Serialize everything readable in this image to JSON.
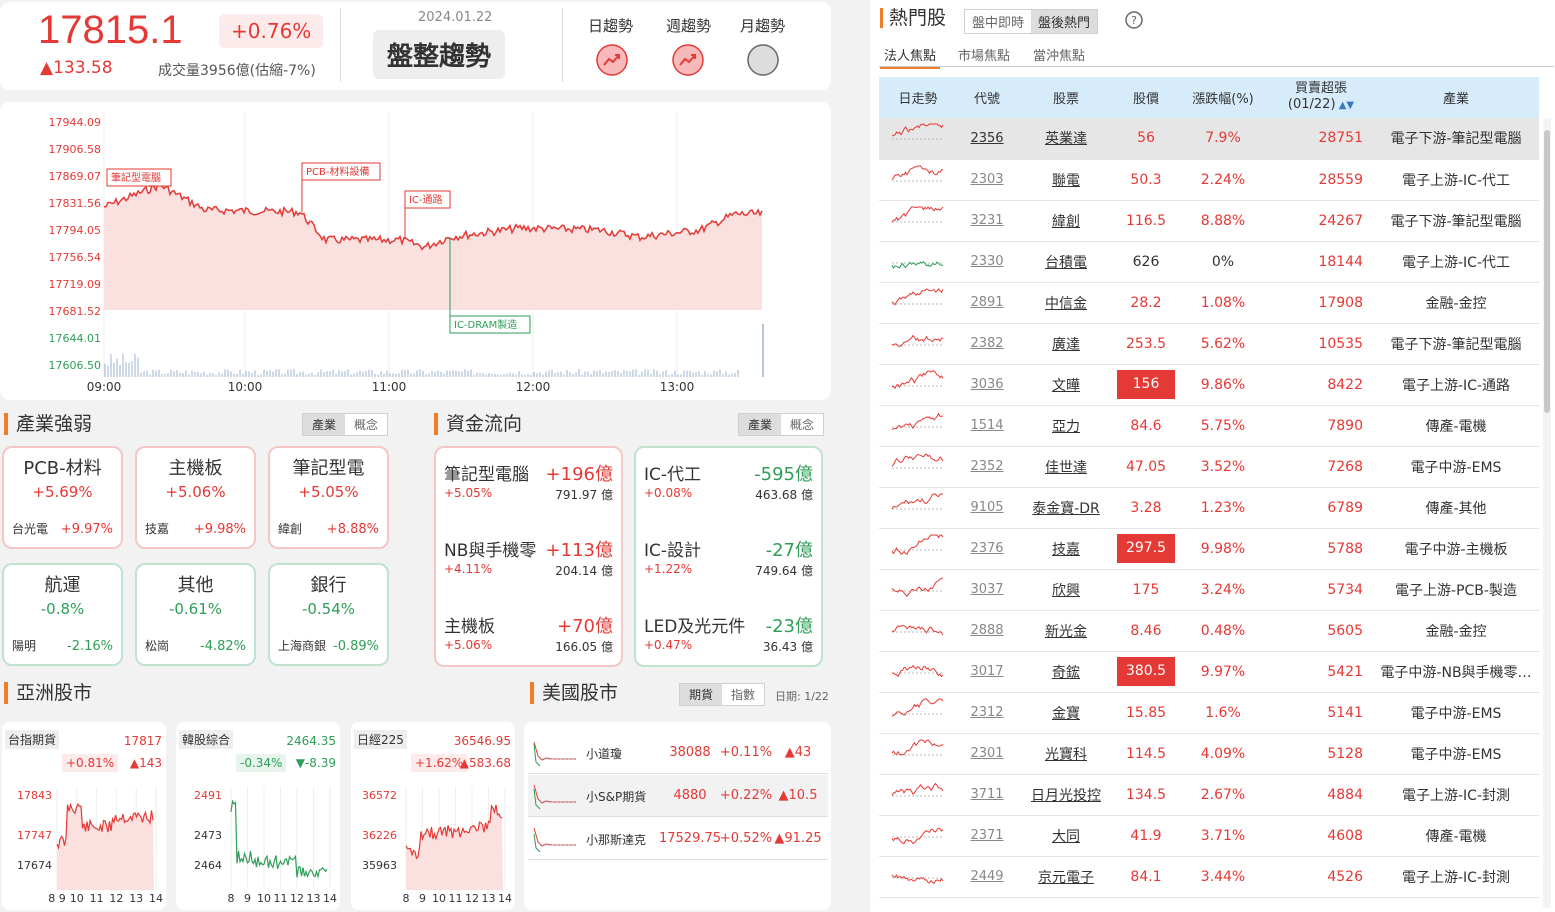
{
  "index": {
    "value": "17815.1",
    "pct": "+0.76%",
    "change": "▲133.58",
    "volume": "成交量3956億(估縮-7%)",
    "date": "2024.01.22",
    "trend": "盤整趨勢",
    "trend_labels": [
      "日趨勢",
      "週趨勢",
      "月趨勢"
    ]
  },
  "intraday": {
    "y_ticks": [
      "17944.09",
      "17906.58",
      "17869.07",
      "17831.56",
      "17794.05",
      "17756.54",
      "17719.09",
      "17681.52",
      "17644.01",
      "17606.50"
    ],
    "x_ticks": [
      "09:00",
      "10:00",
      "11:00",
      "12:00",
      "13:00"
    ],
    "tags": [
      "筆記型電腦",
      "PCB-材料設備",
      "IC-通路",
      "IC-DRAM製造"
    ]
  },
  "sector": {
    "title": "產業強弱",
    "tabs": [
      "產業",
      "概念"
    ],
    "cards": [
      {
        "name": "PCB-材料",
        "pct": "+5.69%",
        "stock": "台光電",
        "stock_pct": "+9.97%",
        "up": true
      },
      {
        "name": "主機板",
        "pct": "+5.06%",
        "stock": "技嘉",
        "stock_pct": "+9.98%",
        "up": true
      },
      {
        "name": "筆記型電",
        "pct": "+5.05%",
        "stock": "緯創",
        "stock_pct": "+8.88%",
        "up": true
      },
      {
        "name": "航運",
        "pct": "-0.8%",
        "stock": "陽明",
        "stock_pct": "-2.16%",
        "up": false
      },
      {
        "name": "其他",
        "pct": "-0.61%",
        "stock": "松崗",
        "stock_pct": "-4.82%",
        "up": false
      },
      {
        "name": "銀行",
        "pct": "-0.54%",
        "stock": "上海商銀",
        "stock_pct": "-0.89%",
        "up": false
      }
    ]
  },
  "flow": {
    "title": "資金流向",
    "tabs": [
      "產業",
      "概念"
    ],
    "in": [
      {
        "name": "筆記型電腦",
        "value": "+196億",
        "pct": "+5.05%",
        "amt": "791.97 億"
      },
      {
        "name": "NB與手機零",
        "value": "+113億",
        "pct": "+4.11%",
        "amt": "204.14 億"
      },
      {
        "name": "主機板",
        "value": "+70億",
        "pct": "+5.06%",
        "amt": "166.05 億"
      }
    ],
    "out": [
      {
        "name": "IC-代工",
        "value": "-595億",
        "pct": "+0.08%",
        "amt": "463.68 億"
      },
      {
        "name": "IC-設計",
        "value": "-27億",
        "pct": "+1.22%",
        "amt": "749.64 億"
      },
      {
        "name": "LED及光元件",
        "value": "-23億",
        "pct": "+0.47%",
        "amt": "36.43 億"
      }
    ]
  },
  "asia": {
    "title": "亞洲股市",
    "charts": [
      {
        "name": "台指期貨",
        "value": "17817",
        "pct": "+0.81%",
        "chg": "▲143",
        "y": [
          "17843",
          "17747",
          "17674"
        ],
        "x": [
          "8 9",
          "10",
          "11",
          "12",
          "13",
          "14"
        ],
        "up": true
      },
      {
        "name": "韓股綜合",
        "value": "2464.35",
        "pct": "-0.34%",
        "chg": "▼-8.39",
        "y": [
          "2491",
          "2473",
          "2464"
        ],
        "x": [
          "8",
          "9",
          "10",
          "11",
          "12",
          "13",
          "14"
        ],
        "up": false
      },
      {
        "name": "日經225",
        "value": "36546.95",
        "pct": "+1.62%",
        "chg": "▲583.68",
        "y": [
          "36572",
          "36226",
          "35963"
        ],
        "x": [
          "8",
          "9",
          "10",
          "11",
          "12",
          "13",
          "14"
        ],
        "up": true
      }
    ]
  },
  "us": {
    "title": "美國股市",
    "tabs": [
      "期貨",
      "指數"
    ],
    "date": "日期: 1/22",
    "rows": [
      {
        "name": "小道瓊",
        "price": "38088",
        "pct": "+0.11%",
        "chg": "▲43"
      },
      {
        "name": "小S&P期貨",
        "price": "4880",
        "pct": "+0.22%",
        "chg": "▲10.5"
      },
      {
        "name": "小那斯達克",
        "price": "17529.75",
        "pct": "+0.52%",
        "chg": "▲91.25"
      }
    ]
  },
  "hot": {
    "title": "熱門股",
    "tabs": [
      "盤中即時",
      "盤後熱門"
    ],
    "subtabs": [
      "法人焦點",
      "市場焦點",
      "當沖焦點"
    ],
    "headers": [
      "日走勢",
      "代號",
      "股票",
      "股價",
      "漲跌幅(%)",
      "買賣超張\n(01/22)",
      "產業"
    ],
    "rows": [
      {
        "code": "2356",
        "name": "英業達",
        "price": "56",
        "pct": "7.9%",
        "vol": "28751",
        "ind": "電子下游-筆記型電腦",
        "limit": false,
        "color": "red"
      },
      {
        "code": "2303",
        "name": "聯電",
        "price": "50.3",
        "pct": "2.24%",
        "vol": "28559",
        "ind": "電子上游-IC-代工",
        "limit": false,
        "color": "red"
      },
      {
        "code": "3231",
        "name": "緯創",
        "price": "116.5",
        "pct": "8.88%",
        "vol": "24267",
        "ind": "電子下游-筆記型電腦",
        "limit": false,
        "color": "red"
      },
      {
        "code": "2330",
        "name": "台積電",
        "price": "626",
        "pct": "0%",
        "vol": "18144",
        "ind": "電子上游-IC-代工",
        "limit": false,
        "color": "flat"
      },
      {
        "code": "2891",
        "name": "中信金",
        "price": "28.2",
        "pct": "1.08%",
        "vol": "17908",
        "ind": "金融-金控",
        "limit": false,
        "color": "red"
      },
      {
        "code": "2382",
        "name": "廣達",
        "price": "253.5",
        "pct": "5.62%",
        "vol": "10535",
        "ind": "電子下游-筆記型電腦",
        "limit": false,
        "color": "red"
      },
      {
        "code": "3036",
        "name": "文曄",
        "price": "156",
        "pct": "9.86%",
        "vol": "8422",
        "ind": "電子上游-IC-通路",
        "limit": true,
        "color": "red"
      },
      {
        "code": "1514",
        "name": "亞力",
        "price": "84.6",
        "pct": "5.75%",
        "vol": "7890",
        "ind": "傳產-電機",
        "limit": false,
        "color": "red"
      },
      {
        "code": "2352",
        "name": "佳世達",
        "price": "47.05",
        "pct": "3.52%",
        "vol": "7268",
        "ind": "電子中游-EMS",
        "limit": false,
        "color": "red"
      },
      {
        "code": "9105",
        "name": "泰金寶-DR",
        "price": "3.28",
        "pct": "1.23%",
        "vol": "6789",
        "ind": "傳產-其他",
        "limit": false,
        "color": "red"
      },
      {
        "code": "2376",
        "name": "技嘉",
        "price": "297.5",
        "pct": "9.98%",
        "vol": "5788",
        "ind": "電子中游-主機板",
        "limit": true,
        "color": "red"
      },
      {
        "code": "3037",
        "name": "欣興",
        "price": "175",
        "pct": "3.24%",
        "vol": "5734",
        "ind": "電子上游-PCB-製造",
        "limit": false,
        "color": "red"
      },
      {
        "code": "2888",
        "name": "新光金",
        "price": "8.46",
        "pct": "0.48%",
        "vol": "5605",
        "ind": "金融-金控",
        "limit": false,
        "color": "red"
      },
      {
        "code": "3017",
        "name": "奇鋐",
        "price": "380.5",
        "pct": "9.97%",
        "vol": "5421",
        "ind": "電子中游-NB與手機零…",
        "limit": true,
        "color": "red"
      },
      {
        "code": "2312",
        "name": "金寶",
        "price": "15.85",
        "pct": "1.6%",
        "vol": "5141",
        "ind": "電子中游-EMS",
        "limit": false,
        "color": "red"
      },
      {
        "code": "2301",
        "name": "光寶科",
        "price": "114.5",
        "pct": "4.09%",
        "vol": "5128",
        "ind": "電子中游-EMS",
        "limit": false,
        "color": "red"
      },
      {
        "code": "3711",
        "name": "日月光投控",
        "price": "134.5",
        "pct": "2.67%",
        "vol": "4884",
        "ind": "電子上游-IC-封測",
        "limit": false,
        "color": "red"
      },
      {
        "code": "2371",
        "name": "大同",
        "price": "41.9",
        "pct": "3.71%",
        "vol": "4608",
        "ind": "傳產-電機",
        "limit": false,
        "color": "red"
      },
      {
        "code": "2449",
        "name": "京元電子",
        "price": "84.1",
        "pct": "3.44%",
        "vol": "4526",
        "ind": "電子上游-IC-封測",
        "limit": false,
        "color": "red"
      }
    ]
  }
}
